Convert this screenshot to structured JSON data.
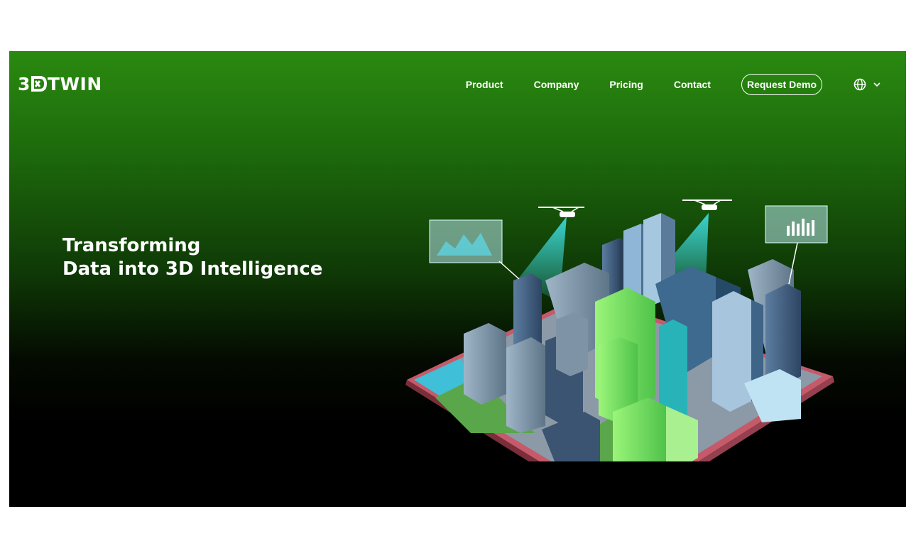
{
  "brand": {
    "logo_text_left": "3",
    "logo_text_right": "TWIN"
  },
  "nav": {
    "items": [
      "Product",
      "Company",
      "Pricing",
      "Contact"
    ],
    "cta": "Request Demo",
    "language_icon": "globe-icon",
    "language_caret": "chevron-down-icon"
  },
  "hero": {
    "line1": "Transforming",
    "line2": "Data into 3D Intelligence"
  },
  "colors": {
    "hero_top": "#2a8a10",
    "hero_bottom": "#000000",
    "accent_green": "#7dff5a",
    "accent_cyan": "#3fe0e6"
  }
}
